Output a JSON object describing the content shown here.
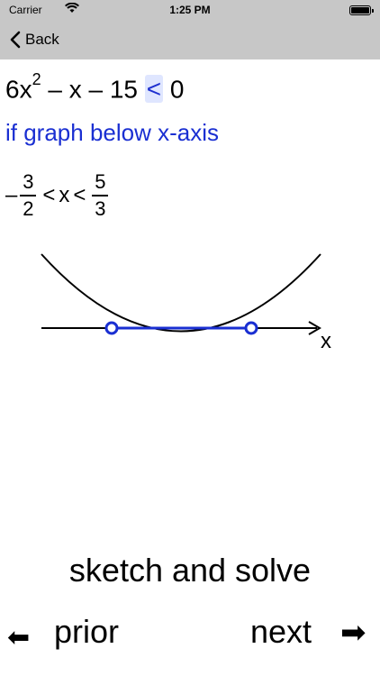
{
  "status_bar": {
    "carrier": "Carrier",
    "time": "1:25 PM",
    "battery_level_percent": 100
  },
  "nav": {
    "back_label": "Back"
  },
  "problem": {
    "lhs": "6x",
    "exponent": "2",
    "rest": " – x – 15 ",
    "operator": "<",
    "rhs": " 0"
  },
  "hint": "if graph below x-axis",
  "solution": {
    "minus": "–",
    "left_num": "3",
    "left_den": "2",
    "op1": "<",
    "variable": "x",
    "op2": "<",
    "right_num": "5",
    "right_den": "3"
  },
  "graph": {
    "axis_label": "x",
    "curve_color": "#000000",
    "solution_color": "#1a2fd2"
  },
  "footer": {
    "title": "sketch and solve",
    "prior_label": "prior",
    "next_label": "next",
    "left_arrow": "⬅",
    "right_arrow": "➡"
  }
}
